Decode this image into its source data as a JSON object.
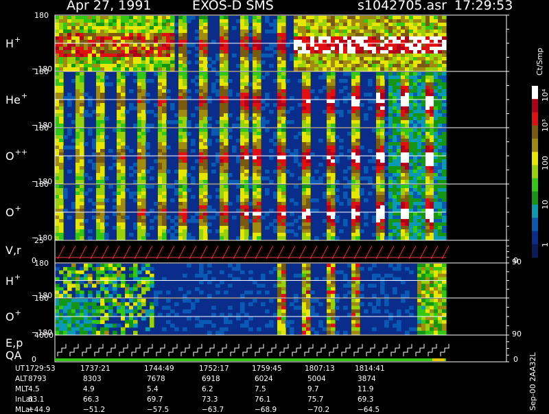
{
  "header": {
    "date": "Apr 27, 1991",
    "instrument": "EXOS-D SMS",
    "file": "s1042705.asr",
    "time": "17:29:53"
  },
  "chart_data": {
    "type": "heatmap",
    "panels": [
      {
        "label": "H",
        "sup": "+",
        "ymax": "180",
        "ymin": "−180",
        "kind": "spectrogram"
      },
      {
        "label": "He",
        "sup": "+",
        "ymax": "180",
        "ymin": "−180",
        "kind": "spectrogram"
      },
      {
        "label": "O",
        "sup": "++",
        "ymax": "180",
        "ymin": "−180",
        "kind": "spectrogram"
      },
      {
        "label": "O",
        "sup": "+",
        "ymax": "180",
        "ymin": "−180",
        "kind": "spectrogram"
      },
      {
        "label": "V,r",
        "sup": "",
        "ymax": "25",
        "ymin": "0",
        "right_top": "90",
        "right_bottom": "0",
        "kind": "line"
      },
      {
        "label": "H",
        "sup": "+",
        "ymax": "180",
        "ymin": "−180",
        "kind": "spectrogram"
      },
      {
        "label": "O",
        "sup": "+",
        "ymax": "180",
        "ymin": "−180",
        "right_top": "90",
        "kind": "spectrogram"
      },
      {
        "label": "E,p",
        "label2": "QA",
        "ymax": "4000",
        "ymin": "0",
        "right_bottom": "0",
        "kind": "step"
      }
    ],
    "colorbar": {
      "title": "Ct/Smp",
      "labels": [
        "10⁴",
        "10³",
        "100",
        "10",
        "1"
      ],
      "colors": [
        "#ffffff",
        "#b0001a",
        "#e01010",
        "#7a5a10",
        "#a08a10",
        "#e6e600",
        "#9ad20a",
        "#32c814",
        "#149614",
        "#0a9ab4",
        "#0a5ab4",
        "#0a2d8c",
        "#0a1a5a"
      ]
    },
    "footer": {
      "rows": [
        {
          "name": "UT",
          "values": [
            "1729:53",
            "1737:21",
            "1744:49",
            "1752:17",
            "1759:45",
            "1807:13",
            "1814:41"
          ]
        },
        {
          "name": "ALT",
          "values": [
            "8793",
            "8303",
            "7678",
            "6918",
            "6024",
            "5004",
            "3874"
          ]
        },
        {
          "name": "MLT",
          "values": [
            "4.5",
            "4.9",
            "5.4",
            "6.2",
            "7.5",
            "9.7",
            "11.9"
          ]
        },
        {
          "name": "InLat",
          "values": [
            "63.1",
            "66.3",
            "69.7",
            "73.3",
            "76.1",
            "75.7",
            "69.3"
          ]
        },
        {
          "name": "MLat",
          "values": [
            "−44.9",
            "−51.2",
            "−57.5",
            "−63.7",
            "−68.9",
            "−70.2",
            "−64.5"
          ]
        }
      ]
    },
    "side_note": "Sep-00 2AA32L"
  }
}
